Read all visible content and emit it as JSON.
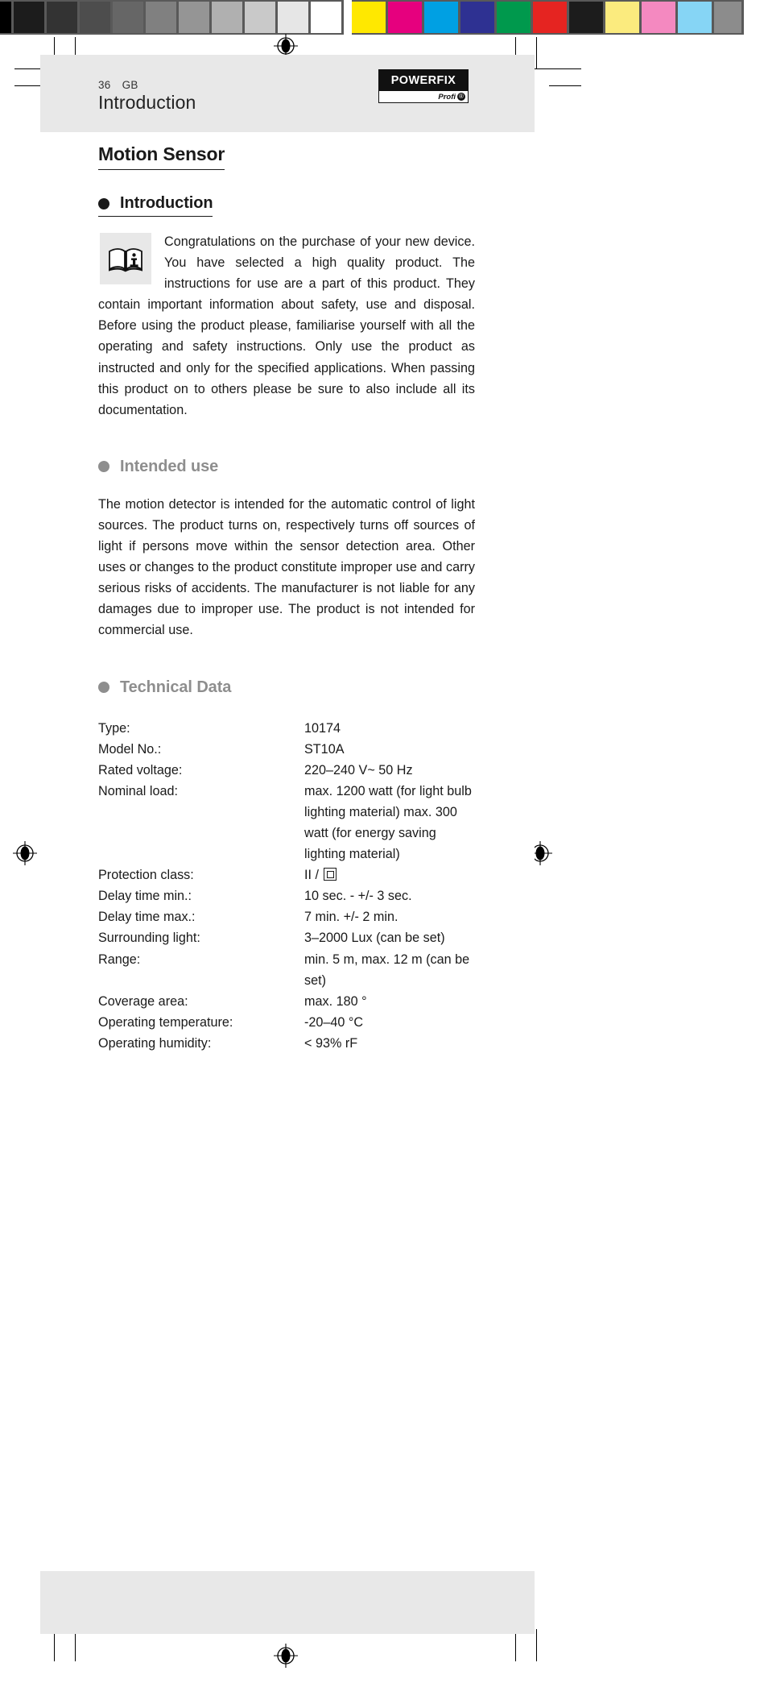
{
  "calibration": {
    "grayscale": [
      "#000000",
      "#1c1c1c",
      "#333333",
      "#4d4d4d",
      "#666666",
      "#808080",
      "#959595",
      "#b0b0b0",
      "#c9c9c9",
      "#e6e6e6",
      "#ffffff"
    ],
    "colors": [
      "#ffe800",
      "#e6007e",
      "#00a0e3",
      "#2e3192",
      "#00994d",
      "#e52421",
      "#1c1c1c",
      "#fbeb7e",
      "#f489c0",
      "#86d5f5",
      "#8c8c8c"
    ],
    "bar_background": "#595959"
  },
  "header": {
    "running_title": "Introduction"
  },
  "document": {
    "title": "Motion Sensor"
  },
  "sections": {
    "introduction": {
      "heading": "Introduction",
      "icon": "manual-book-info-icon",
      "body": "Congratulations on the purchase of your new device. You have selected a high quality product. The instructions for use are a part of this product. They contain important information about safety, use and disposal. Before using the product please, familiarise yourself with all the operating and safety instructions. Only use the product as instructed and only for the specified applications. When passing this product on to others please be sure to also include all its documentation."
    },
    "intended_use": {
      "heading": "Intended use",
      "body": "The motion detector is intended for the automatic control of light sources. The product turns on, respectively turns off sources of light if persons move within the sensor detection area. Other uses or changes to the product constitute improper use and carry serious risks of accidents. The manufacturer is not liable for any damages due to improper use. The product is not intended for commercial use."
    },
    "technical_data": {
      "heading": "Technical Data",
      "rows": [
        {
          "label": "Type:",
          "value": "10174"
        },
        {
          "label": "Model No.:",
          "value": "ST10A"
        },
        {
          "label": "Rated voltage:",
          "value": "220–240 V~ 50 Hz"
        },
        {
          "label": "Nominal load:",
          "value": "max. 1200 watt (for light bulb lighting material) max. 300 watt (for energy saving lighting material)"
        },
        {
          "label": "Protection class:",
          "value": "II /",
          "symbol": "double-insulation-square-icon"
        },
        {
          "label": "Delay time min.:",
          "value": "10 sec. - +/- 3 sec."
        },
        {
          "label": "Delay time max.:",
          "value": "7 min. +/- 2 min."
        },
        {
          "label": "Surrounding light:",
          "value": "3–2000 Lux (can be set)"
        },
        {
          "label": "Range:",
          "value": "min. 5 m, max. 12 m (can be set)"
        },
        {
          "label": "Coverage area:",
          "value": "max. 180 °"
        },
        {
          "label": "Operating temperature:",
          "value": "-20–40 °C"
        },
        {
          "label": "Operating humidity:",
          "value": "< 93% rF"
        }
      ]
    }
  },
  "footer": {
    "page_number": "36",
    "language_code": "GB",
    "logo": {
      "brand": "POWERFIX",
      "sub": "Profi",
      "mark": "®"
    }
  },
  "colors": {
    "band": "#e8e8e8",
    "text": "#1a1a1a",
    "muted_heading": "#8e8e8e"
  }
}
